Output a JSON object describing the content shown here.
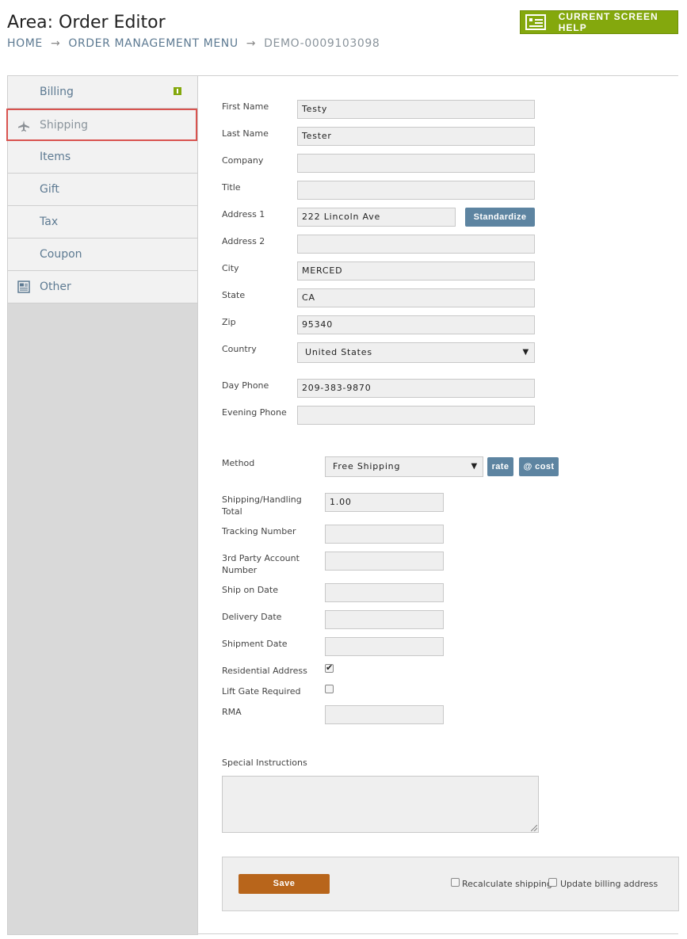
{
  "header": {
    "title": "Area: Order Editor",
    "breadcrumb": [
      "HOME",
      "ORDER MANAGEMENT MENU",
      "DEMO-0009103098"
    ],
    "separator": "→",
    "help_label": "CURRENT SCREEN HELP"
  },
  "sidebar": {
    "items": [
      {
        "label": "Billing",
        "icon": "info-badge-icon"
      },
      {
        "label": "Shipping",
        "icon": "airplane-icon",
        "active": true
      },
      {
        "label": "Items"
      },
      {
        "label": "Gift"
      },
      {
        "label": "Tax"
      },
      {
        "label": "Coupon"
      },
      {
        "label": "Other",
        "icon": "newspaper-icon"
      }
    ]
  },
  "address": {
    "first_name": {
      "label": "First Name",
      "value": "Testy"
    },
    "last_name": {
      "label": "Last Name",
      "value": "Tester"
    },
    "company": {
      "label": "Company",
      "value": ""
    },
    "title": {
      "label": "Title",
      "value": ""
    },
    "address1": {
      "label": "Address 1",
      "value": "222 Lincoln Ave"
    },
    "standardize_label": "Standardize",
    "address2": {
      "label": "Address 2",
      "value": ""
    },
    "city": {
      "label": "City",
      "value": "MERCED"
    },
    "state": {
      "label": "State",
      "value": "CA"
    },
    "zip": {
      "label": "Zip",
      "value": "95340"
    },
    "country": {
      "label": "Country",
      "value": "United States"
    },
    "day_phone": {
      "label": "Day Phone",
      "value": "209-383-9870"
    },
    "evening_phone": {
      "label": "Evening Phone",
      "value": ""
    }
  },
  "shipping": {
    "method": {
      "label": "Method",
      "value": "Free Shipping"
    },
    "rate_label": "rate",
    "cost_label": "@ cost",
    "handling_total": {
      "label_line1": "Shipping/Handling",
      "label_line2": "Total",
      "value": "1.00"
    },
    "tracking_number": {
      "label": "Tracking Number",
      "value": ""
    },
    "third_party": {
      "label_line1": "3rd Party Account",
      "label_line2": "Number",
      "value": ""
    },
    "ship_on_date": {
      "label": "Ship on Date",
      "value": ""
    },
    "delivery_date": {
      "label": "Delivery Date",
      "value": ""
    },
    "shipment_date": {
      "label": "Shipment Date",
      "value": ""
    },
    "residential": {
      "label": "Residential Address",
      "checked": true
    },
    "lift_gate": {
      "label": "Lift Gate Required",
      "checked": false
    },
    "rma": {
      "label": "RMA",
      "value": ""
    },
    "special_instructions": {
      "label": "Special Instructions",
      "value": ""
    }
  },
  "footer": {
    "save_label": "Save",
    "recalculate_label": "Recalculate shipping",
    "update_billing_label": "Update billing address"
  },
  "colors": {
    "accent_green": "#84a80d",
    "button_blue": "#5d84a1",
    "save_orange": "#b8651b",
    "active_outline": "#d9534f"
  }
}
